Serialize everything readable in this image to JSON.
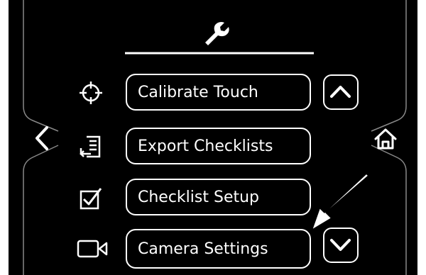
{
  "header": {
    "icon": "wrench-icon"
  },
  "nav": {
    "back_icon": "chevron-left-icon",
    "home_icon": "home-icon",
    "scroll_up_icon": "chevron-up-icon",
    "scroll_down_icon": "chevron-down-icon"
  },
  "menu": {
    "items": [
      {
        "label": "Calibrate Touch",
        "icon": "crosshair-icon"
      },
      {
        "label": "Export Checklists",
        "icon": "export-list-icon"
      },
      {
        "label": "Checklist Setup",
        "icon": "checkbox-icon"
      },
      {
        "label": "Camera Settings",
        "icon": "camera-icon"
      }
    ]
  },
  "annotation": {
    "icon": "arrow-pointer-icon"
  },
  "colors": {
    "background": "#000000",
    "foreground": "#ffffff",
    "page": "#ffffff"
  }
}
